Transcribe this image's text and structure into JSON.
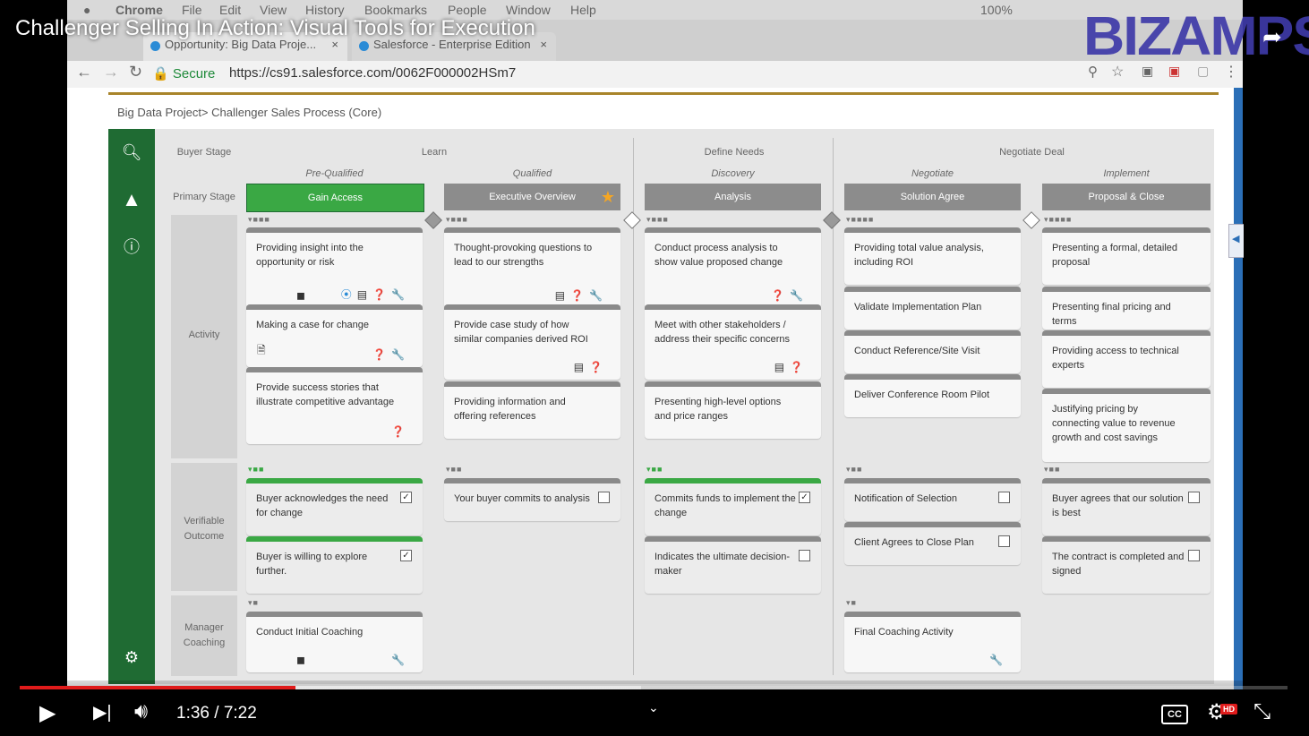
{
  "mac_menu": {
    "items": [
      "Chrome",
      "File",
      "Edit",
      "View",
      "History",
      "Bookmarks",
      "People",
      "Window",
      "Help"
    ],
    "battery": "100%"
  },
  "browser": {
    "tabs": [
      {
        "label": "Opportunity: Big Data Proje...",
        "close": "×"
      },
      {
        "label": "Salesforce - Enterprise Edition",
        "close": "×"
      }
    ],
    "secure_label": "Secure",
    "url": "https://cs91.salesforce.com/0062F000002HSm7"
  },
  "breadcrumb": "Big Data Project> Challenger Sales Process (Core)",
  "board": {
    "buyer_stage_label": "Buyer Stage",
    "primary_stage_label": "Primary Stage",
    "row_labels": {
      "activity": "Activity",
      "verifiable": "Verifiable Outcome",
      "coaching": "Manager Coaching"
    },
    "buyer_stages": [
      "Learn",
      "Define Needs",
      "Negotiate Deal"
    ],
    "columns": [
      {
        "substage": "Pre-Qualified",
        "stage": "Gain Access",
        "state": "current",
        "activities": [
          {
            "text": "Providing insight into the opportunity or risk"
          },
          {
            "text": "Making a case for change"
          },
          {
            "text": "Provide success stories that illustrate competitive advantage"
          }
        ],
        "outcomes": [
          {
            "text": "Buyer acknowledges the need for change",
            "checked": true
          },
          {
            "text": "Buyer is willing to explore further.",
            "checked": true
          }
        ],
        "coaching": [
          {
            "text": "Conduct Initial Coaching"
          }
        ]
      },
      {
        "substage": "Qualified",
        "stage": "Executive Overview",
        "state": "starred",
        "activities": [
          {
            "text": "Thought-provoking questions to lead to our strengths"
          },
          {
            "text": "Provide case study of how similar companies derived ROI"
          },
          {
            "text": "Providing information and offering references"
          }
        ],
        "outcomes": [
          {
            "text": "Your buyer commits to analysis",
            "checked": false
          }
        ],
        "coaching": []
      },
      {
        "substage": "Discovery",
        "stage": "Analysis",
        "state": "future",
        "activities": [
          {
            "text": "Conduct process analysis to show value proposed change"
          },
          {
            "text": "Meet with other stakeholders / address their specific concerns"
          },
          {
            "text": "Presenting high-level options and price ranges"
          }
        ],
        "outcomes": [
          {
            "text": "Commits funds to implement the change",
            "checked": true
          },
          {
            "text": "Indicates the ultimate decision-maker",
            "checked": false
          }
        ],
        "coaching": []
      },
      {
        "substage": "Negotiate",
        "stage": "Solution Agree",
        "state": "future",
        "activities": [
          {
            "text": "Providing total value analysis, including ROI"
          },
          {
            "text": "Validate Implementation Plan"
          },
          {
            "text": "Conduct Reference/Site Visit"
          },
          {
            "text": "Deliver Conference Room Pilot"
          }
        ],
        "outcomes": [
          {
            "text": "Notification of Selection",
            "checked": false
          },
          {
            "text": "Client Agrees to Close Plan",
            "checked": false
          }
        ],
        "coaching": [
          {
            "text": "Final Coaching Activity"
          }
        ]
      },
      {
        "substage": "Implement",
        "stage": "Proposal & Close",
        "state": "future",
        "activities": [
          {
            "text": "Presenting a formal, detailed proposal"
          },
          {
            "text": "Presenting final pricing and terms"
          },
          {
            "text": "Providing access to technical experts"
          },
          {
            "text": "Justifying pricing by connecting value to revenue growth and cost savings"
          }
        ],
        "outcomes": [
          {
            "text": "Buyer agrees that our solution is best",
            "checked": false
          },
          {
            "text": "The contract is completed and signed",
            "checked": false
          }
        ],
        "coaching": []
      }
    ]
  },
  "video": {
    "title": "Challenger Selling In Action: Visual Tools for Execution",
    "channel_logo": "BIZAMPS",
    "time_current": "1:36",
    "time_total": "7:22",
    "time_label": "1:36 / 7:22",
    "progress": 0.2172,
    "buffered": 0.49,
    "cc_label": "CC",
    "hd_badge": "HD"
  },
  "colors": {
    "green_dark": "#1f6b33",
    "green_stage": "#3aa844",
    "progress_red": "#e01b1b",
    "gold": "#a8842a"
  }
}
